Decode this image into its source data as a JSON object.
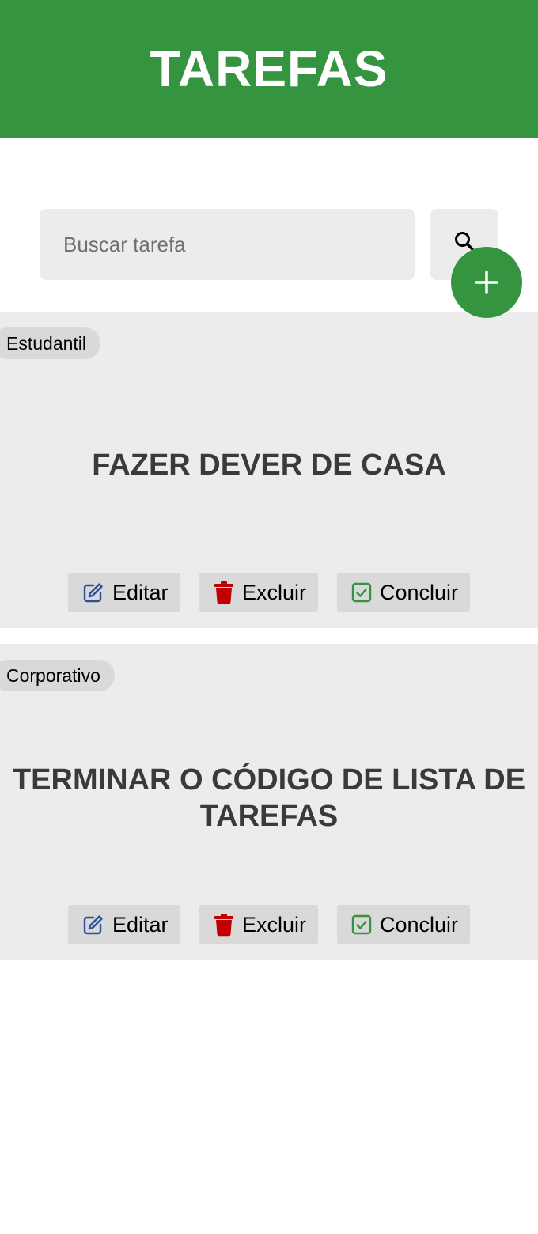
{
  "header": {
    "title": "TAREFAS"
  },
  "search": {
    "placeholder": "Buscar tarefa",
    "value": ""
  },
  "colors": {
    "brand": "#359440",
    "edit_icon": "#2f4f9a",
    "delete_icon": "#c00000",
    "done_icon": "#359440"
  },
  "tasks": [
    {
      "category": "Estudantil",
      "title": "FAZER DEVER DE CASA",
      "actions": {
        "edit": "Editar",
        "delete": "Excluir",
        "done": "Concluir"
      }
    },
    {
      "category": "Corporativo",
      "title": "TERMINAR O CÓDIGO DE LISTA DE TAREFAS",
      "actions": {
        "edit": "Editar",
        "delete": "Excluir",
        "done": "Concluir"
      }
    }
  ]
}
